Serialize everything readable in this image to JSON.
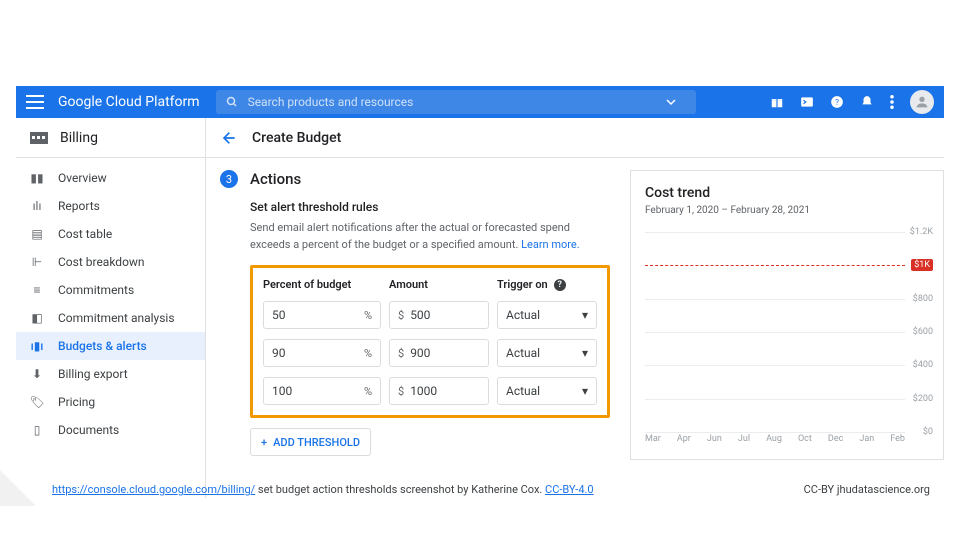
{
  "topbar": {
    "brand": "Google Cloud Platform",
    "search_placeholder": "Search products and resources"
  },
  "sidebar": {
    "title": "Billing",
    "items": [
      {
        "label": "Overview"
      },
      {
        "label": "Reports"
      },
      {
        "label": "Cost table"
      },
      {
        "label": "Cost breakdown"
      },
      {
        "label": "Commitments"
      },
      {
        "label": "Commitment analysis"
      },
      {
        "label": "Budgets & alerts"
      },
      {
        "label": "Billing export"
      },
      {
        "label": "Pricing"
      },
      {
        "label": "Documents"
      }
    ]
  },
  "main": {
    "page_title": "Create Budget",
    "step_number": "3",
    "step_title": "Actions",
    "section_title": "Set alert threshold rules",
    "section_desc": "Send email alert notifications after the actual or forecasted spend exceeds a percent of the budget or a specified amount. ",
    "learn_more": "Learn more.",
    "headers": {
      "percent": "Percent of budget",
      "amount": "Amount",
      "trigger": "Trigger on"
    },
    "rows": [
      {
        "percent": "50",
        "amount": "500",
        "trigger": "Actual"
      },
      {
        "percent": "90",
        "amount": "900",
        "trigger": "Actual"
      },
      {
        "percent": "100",
        "amount": "1000",
        "trigger": "Actual"
      }
    ],
    "add_threshold": "ADD THRESHOLD"
  },
  "chart": {
    "title": "Cost trend",
    "subtitle": "February 1, 2020 – February 28, 2021"
  },
  "chart_data": {
    "type": "line",
    "title": "Cost trend",
    "xlabel": "",
    "ylabel": "",
    "ylim": [
      0,
      1200
    ],
    "y_ticks": [
      0,
      200,
      400,
      600,
      800,
      1200
    ],
    "y_tick_labels": [
      "$0",
      "$200",
      "$400",
      "$600",
      "$800",
      "$1.2K"
    ],
    "budget_line": {
      "value": 1000,
      "label": "$1K",
      "color": "#d93025"
    },
    "x_tick_labels": [
      "Mar",
      "Apr",
      "Jun",
      "Jul",
      "Aug",
      "Oct",
      "Dec",
      "Jan",
      "Feb"
    ],
    "series": []
  },
  "footer": {
    "url": "https://console.cloud.google.com/billing/",
    "desc": " set budget action thresholds  screenshot by Katherine Cox. ",
    "license": "CC-BY-4.0",
    "right": "CC-BY  jhudatascience.org"
  }
}
